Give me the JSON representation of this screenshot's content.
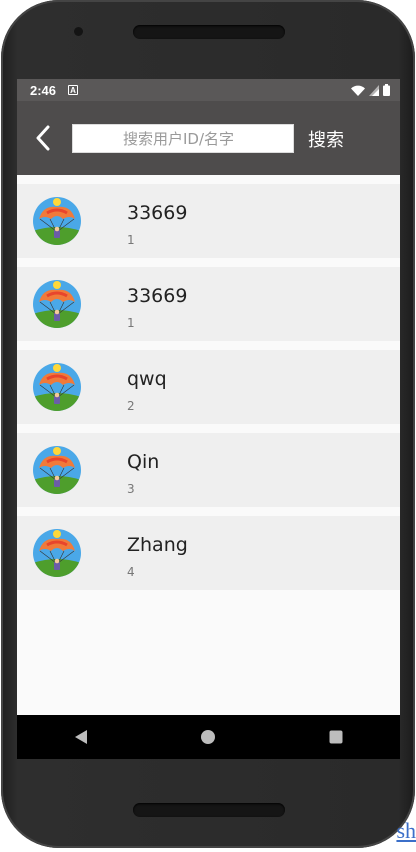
{
  "status_bar": {
    "time": "2:46",
    "notification_icon": "a-icon"
  },
  "header": {
    "back_icon": "back-arrow-icon",
    "search_placeholder": "搜索用户ID/名字",
    "search_value": "",
    "search_button": "搜索"
  },
  "users": [
    {
      "name": "33669",
      "id": "1"
    },
    {
      "name": "33669",
      "id": "1"
    },
    {
      "name": "qwq",
      "id": "2"
    },
    {
      "name": "Qin",
      "id": "3"
    },
    {
      "name": "Zhang",
      "id": "4"
    }
  ],
  "nav_bar": {
    "back": "back-triangle-icon",
    "home": "home-circle-icon",
    "recents": "recents-square-icon"
  },
  "colors": {
    "app_bar": "#4e4c4c",
    "status_bar": "#5a5858",
    "row_bg": "#efefef"
  },
  "side_link": "sh"
}
